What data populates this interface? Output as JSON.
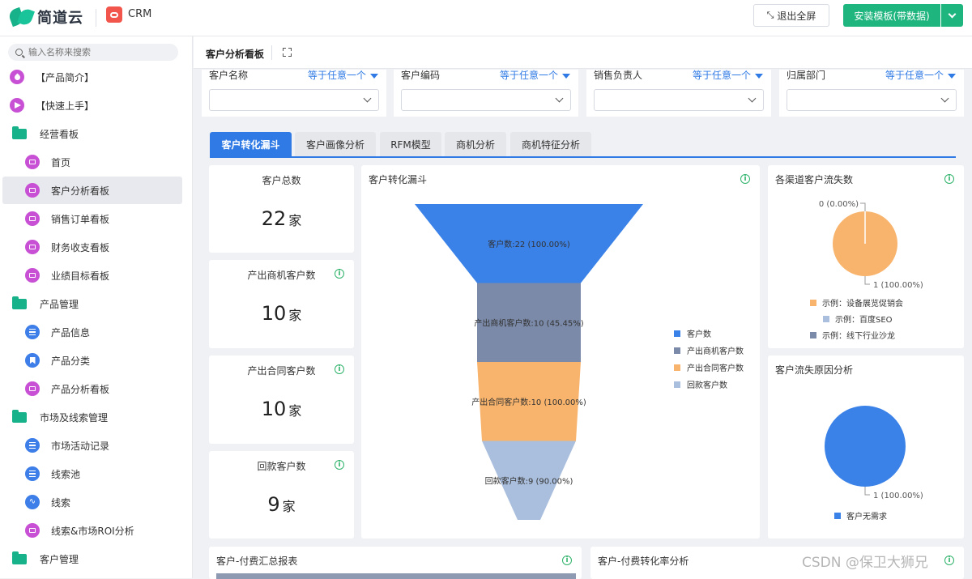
{
  "brand": {
    "name": "简道云"
  },
  "app": {
    "name": "CRM"
  },
  "header": {
    "exit_label": "退出全屏",
    "install_label": "安装模板(带数据)"
  },
  "sidebar": {
    "search_placeholder": "输入名称来搜索",
    "items": [
      {
        "label": "【产品简介】",
        "level": "top",
        "icon": "tag-icon"
      },
      {
        "label": "【快速上手】",
        "level": "top",
        "icon": "send-icon"
      },
      {
        "label": "经营看板",
        "level": "group",
        "icon": "folder-icon"
      },
      {
        "label": "首页",
        "level": "sub",
        "icon": "dashboard-icon"
      },
      {
        "label": "客户分析看板",
        "level": "sub",
        "icon": "dashboard-icon",
        "active": true
      },
      {
        "label": "销售订单看板",
        "level": "sub",
        "icon": "dashboard-icon"
      },
      {
        "label": "财务收支看板",
        "level": "sub",
        "icon": "dashboard-icon"
      },
      {
        "label": "业绩目标看板",
        "level": "sub",
        "icon": "dashboard-icon"
      },
      {
        "label": "产品管理",
        "level": "group",
        "icon": "folder-icon"
      },
      {
        "label": "产品信息",
        "level": "sub",
        "icon": "form-icon"
      },
      {
        "label": "产品分类",
        "level": "sub",
        "icon": "bookmark-icon"
      },
      {
        "label": "产品分析看板",
        "level": "sub",
        "icon": "dashboard-icon"
      },
      {
        "label": "市场及线索管理",
        "level": "group",
        "icon": "folder-icon"
      },
      {
        "label": "市场活动记录",
        "level": "sub",
        "icon": "form-icon"
      },
      {
        "label": "线索池",
        "level": "sub",
        "icon": "form-icon"
      },
      {
        "label": "线索",
        "level": "sub",
        "icon": "flow-icon"
      },
      {
        "label": "线索&市场ROI分析",
        "level": "sub",
        "icon": "dashboard-icon"
      },
      {
        "label": "客户管理",
        "level": "group",
        "icon": "folder-icon"
      }
    ]
  },
  "main": {
    "title": "客户分析看板"
  },
  "filters": [
    {
      "label": "客户名称",
      "operator": "等于任意一个"
    },
    {
      "label": "客户编码",
      "operator": "等于任意一个"
    },
    {
      "label": "销售负责人",
      "operator": "等于任意一个"
    },
    {
      "label": "归属部门",
      "operator": "等于任意一个"
    }
  ],
  "tabs": [
    "客户转化漏斗",
    "客户画像分析",
    "RFM模型",
    "商机分析",
    "商机特征分析"
  ],
  "kpis": [
    {
      "title": "客户总数",
      "value": "22",
      "unit": "家"
    },
    {
      "title": "产出商机客户数",
      "value": "10",
      "unit": "家"
    },
    {
      "title": "产出合同客户数",
      "value": "10",
      "unit": "家"
    },
    {
      "title": "回款客户数",
      "value": "9",
      "unit": "家"
    }
  ],
  "funnel_card": {
    "title": "客户转化漏斗"
  },
  "churn_card": {
    "title": "各渠道客户流失数"
  },
  "reason_card": {
    "title": "客户流失原因分析"
  },
  "bottom_cards": {
    "left_title": "客户-付费汇总报表",
    "right_title": "客户-付费转化率分析"
  },
  "watermark": "CSDN @保卫大狮兄",
  "chart_data": [
    {
      "type": "funnel",
      "title": "客户转化漏斗",
      "series": [
        {
          "name": "客户数",
          "value": 22,
          "label": "客户数:22 (100.00%)",
          "color": "#3b82e8"
        },
        {
          "name": "产出商机客户数",
          "value": 10,
          "label": "产出商机客户数:10 (45.45%)",
          "color": "#7b8aa8"
        },
        {
          "name": "产出合同客户数",
          "value": 10,
          "label": "产出合同客户数:10 (100.00%)",
          "color": "#f8b46c"
        },
        {
          "name": "回款客户数",
          "value": 9,
          "label": "回款客户数:9 (90.00%)",
          "color": "#aabfdd"
        }
      ],
      "legend": "right"
    },
    {
      "type": "pie",
      "title": "各渠道客户流失数",
      "slices": [
        {
          "name": "示例：设备展览促销会",
          "value": 1,
          "label": "1 (100.00%)",
          "color": "#f8b46c"
        },
        {
          "name": "示例：百度SEO",
          "value": 0,
          "label": "0 (0.00%)",
          "color": "#aabfdd"
        },
        {
          "name": "示例：线下行业沙龙",
          "value": 0,
          "color": "#7b8aa8"
        }
      ],
      "legend": "bottom"
    },
    {
      "type": "pie",
      "title": "客户流失原因分析",
      "slices": [
        {
          "name": "客户无需求",
          "value": 1,
          "label": "1 (100.00%)",
          "color": "#3b82e8"
        }
      ],
      "legend": "bottom"
    }
  ]
}
